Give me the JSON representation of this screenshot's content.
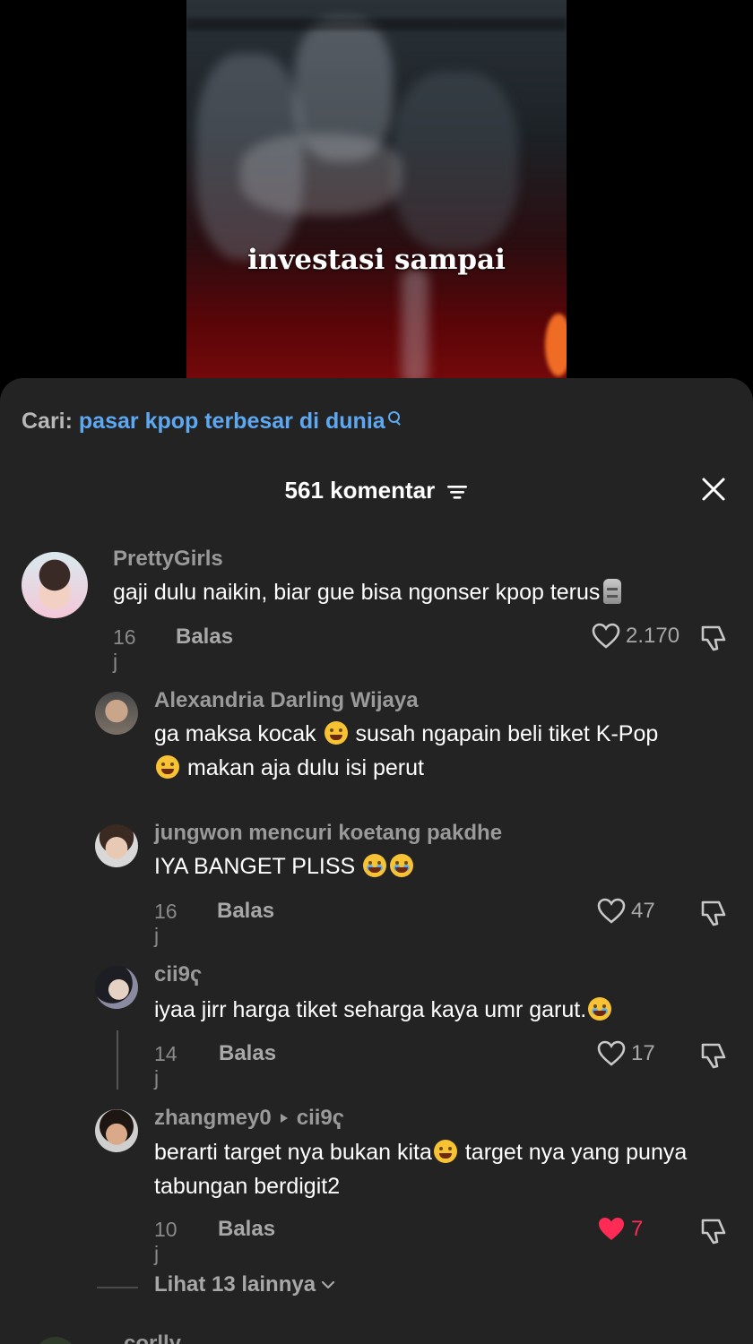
{
  "video": {
    "caption": "investasi sampai"
  },
  "search": {
    "label": "Cari: ",
    "query": "pasar kpop terbesar di dunia"
  },
  "header": {
    "title": "561 komentar"
  },
  "comments": [
    {
      "username": "PrettyGirls",
      "text": "gaji dulu naikin, biar gue bisa ngonser kpop terus",
      "time": "16 j",
      "reply_label": "Balas",
      "likes": "2.170"
    },
    {
      "username": "Alexandria Darling Wijaya",
      "text_a": "ga maksa kocak",
      "text_b": " susah ngapain beli tiket K-Pop",
      "text_c": " makan aja dulu isi perut"
    },
    {
      "username": "jungwon mencuri koetang pakdhe",
      "text": "IYA BANGET PLISS",
      "time": "16 j",
      "reply_label": "Balas",
      "likes": "47"
    },
    {
      "username": "cii9ҁ",
      "text": "iyaa jirr harga tiket seharga kaya umr garut.",
      "time": "14 j",
      "reply_label": "Balas",
      "likes": "17"
    },
    {
      "username": "zhangmey0",
      "reply_to": "cii9ҁ",
      "text_a": "berarti target nya bukan kita",
      "text_b": " target nya yang punya tabungan berdigit2",
      "time": "10 j",
      "reply_label": "Balas",
      "likes": "7"
    }
  ],
  "more": {
    "label": "Lihat 13 lainnya"
  },
  "partial": {
    "username": "corlly"
  },
  "colors": {
    "sheet_bg": "#232323",
    "link_blue": "#5ea8f2",
    "liked_red": "#fe2c55"
  }
}
